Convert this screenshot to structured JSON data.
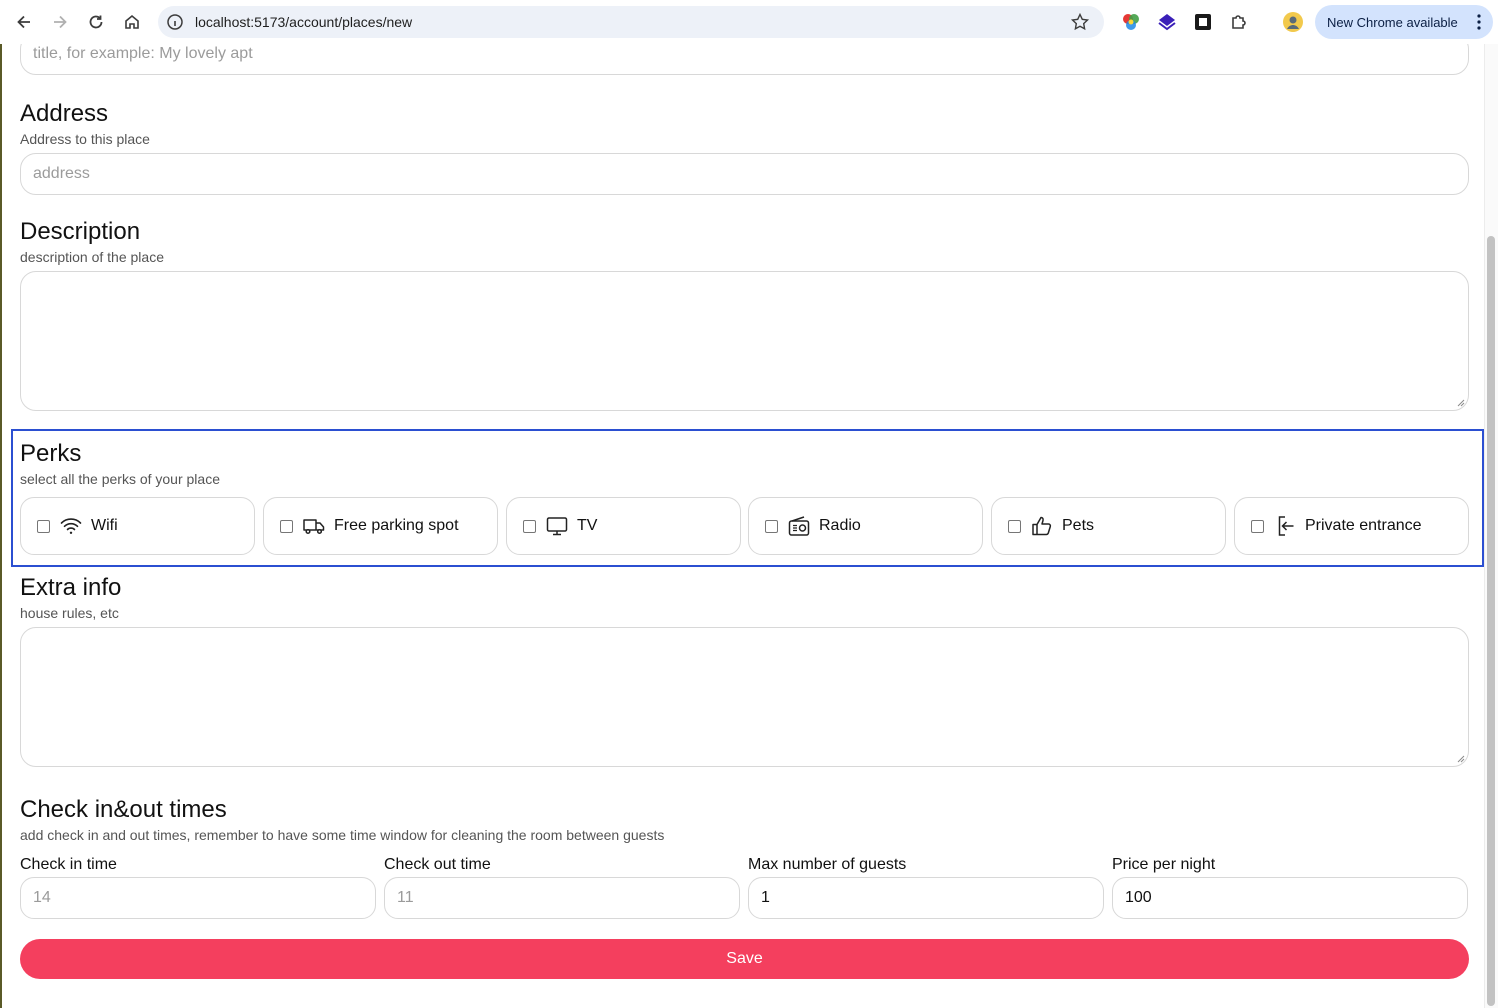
{
  "browser": {
    "url": "localhost:5173/account/places/new",
    "update_label": "New Chrome available"
  },
  "form": {
    "title": {
      "placeholder": "title, for example: My lovely apt"
    },
    "address": {
      "heading": "Address",
      "subtitle": "Address to this place",
      "placeholder": "address"
    },
    "description": {
      "heading": "Description",
      "subtitle": "description of the place"
    },
    "perks": {
      "heading": "Perks",
      "subtitle": "select all the perks of your place",
      "items": [
        {
          "label": "Wifi",
          "icon": "wifi-icon",
          "checked": false
        },
        {
          "label": "Free parking spot",
          "icon": "truck-icon",
          "checked": false
        },
        {
          "label": "TV",
          "icon": "tv-icon",
          "checked": false
        },
        {
          "label": "Radio",
          "icon": "radio-icon",
          "checked": false
        },
        {
          "label": "Pets",
          "icon": "thumbs-up-icon",
          "checked": false
        },
        {
          "label": "Private entrance",
          "icon": "entrance-icon",
          "checked": false
        }
      ]
    },
    "extra_info": {
      "heading": "Extra info",
      "subtitle": "house rules, etc"
    },
    "times": {
      "heading": "Check in&out times",
      "subtitle": "add check in and out times, remember to have some time window for cleaning the room between guests",
      "check_in": {
        "label": "Check in time",
        "placeholder": "14"
      },
      "check_out": {
        "label": "Check out time",
        "placeholder": "11"
      },
      "max_guests": {
        "label": "Max number of guests",
        "value": "1"
      },
      "price": {
        "label": "Price per night",
        "value": "100"
      }
    },
    "save_label": "Save"
  },
  "colors": {
    "accent": "#f43f5e",
    "focus_outline": "#2b4fd1"
  }
}
